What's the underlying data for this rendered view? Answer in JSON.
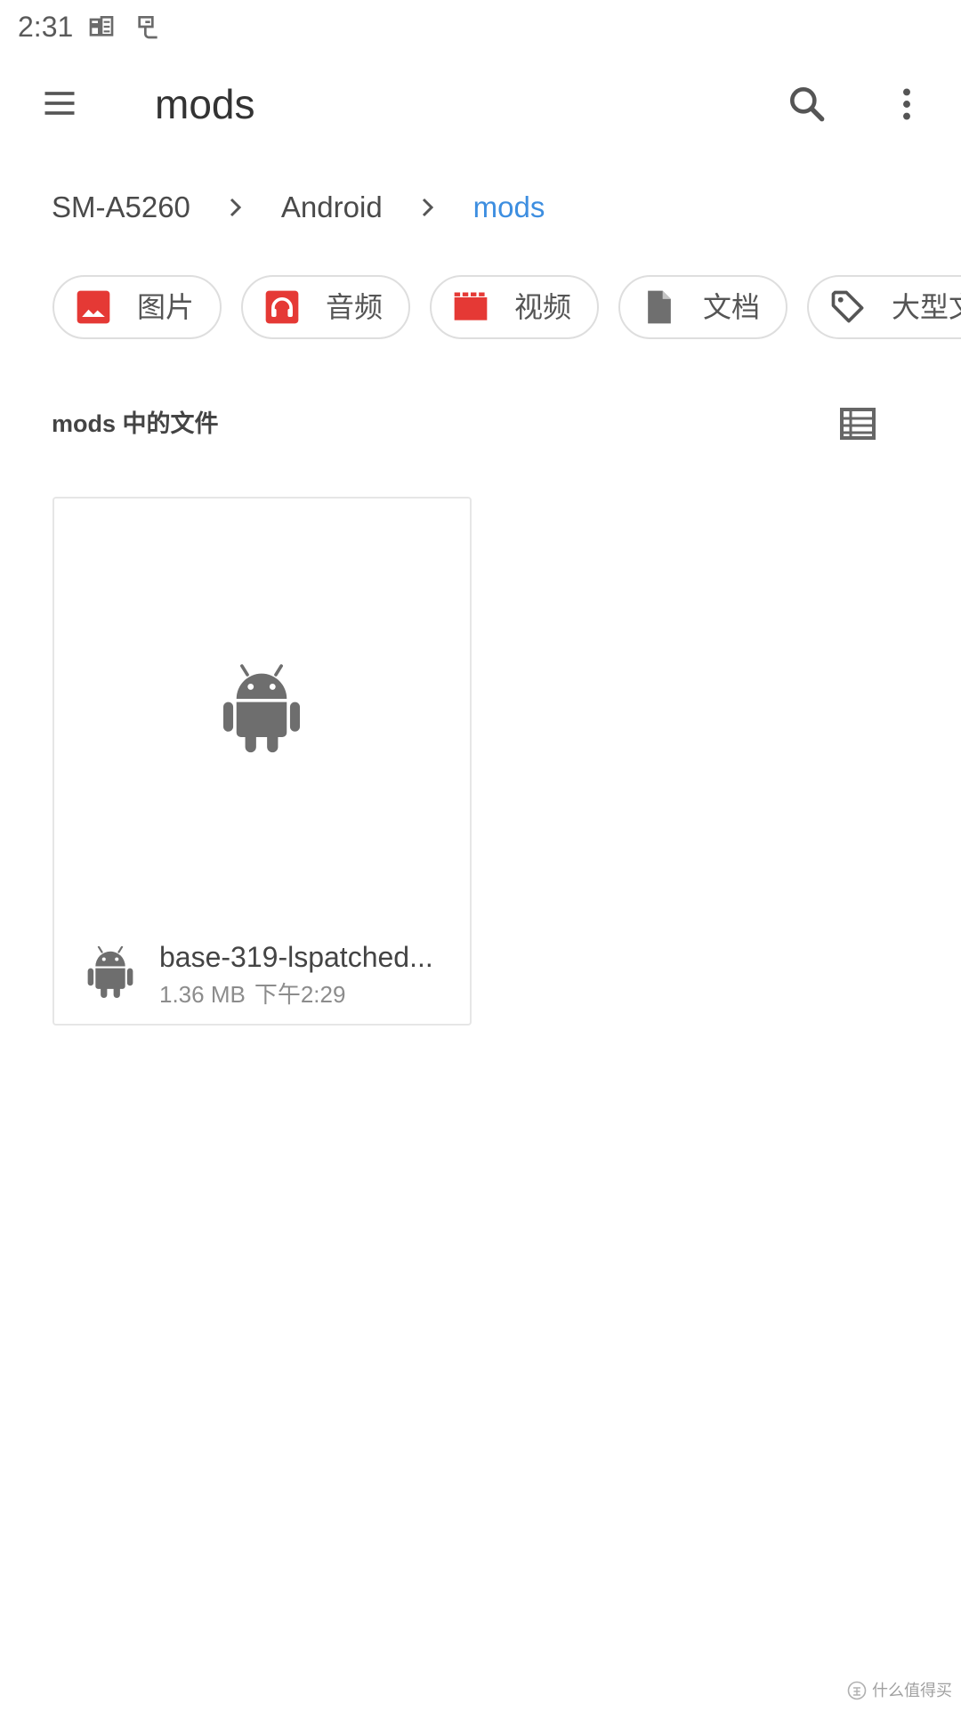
{
  "status_bar": {
    "time": "2:31",
    "notification_icons": [
      "app-notification-icon",
      "app-notification-icon"
    ]
  },
  "app_bar": {
    "title": "mods",
    "menu_icon": "menu-icon",
    "search_icon": "search-icon",
    "more_icon": "more-vert-icon"
  },
  "breadcrumb": {
    "separator_icon": "chevron-right-icon",
    "items": [
      {
        "label": "SM-A5260",
        "active": false
      },
      {
        "label": "Android",
        "active": false
      },
      {
        "label": "mods",
        "active": true
      }
    ]
  },
  "filter_chips": [
    {
      "label": "图片",
      "icon": "image-icon"
    },
    {
      "label": "音频",
      "icon": "audio-icon"
    },
    {
      "label": "视频",
      "icon": "video-icon"
    },
    {
      "label": "文档",
      "icon": "document-icon"
    },
    {
      "label": "大型文",
      "icon": "tag-icon"
    }
  ],
  "section": {
    "title": "mods 中的文件",
    "view_toggle_icon": "list-view-icon"
  },
  "files": [
    {
      "name": "base-319-lspatched...",
      "size": "1.36 MB",
      "modified": "下午2:29",
      "thumbnail_icon": "android-icon",
      "type_icon": "android-icon"
    }
  ],
  "watermark": {
    "text": "什么值得买",
    "logo_icon": "smzdm-logo-icon"
  },
  "colors": {
    "accent": "#3d8ee0",
    "chip_icon_red": "#e53935",
    "icon_gray": "#6e6e6e",
    "text_primary": "#444444",
    "text_secondary": "#8c8c8c",
    "border": "#dedede",
    "background": "#ffffff"
  }
}
